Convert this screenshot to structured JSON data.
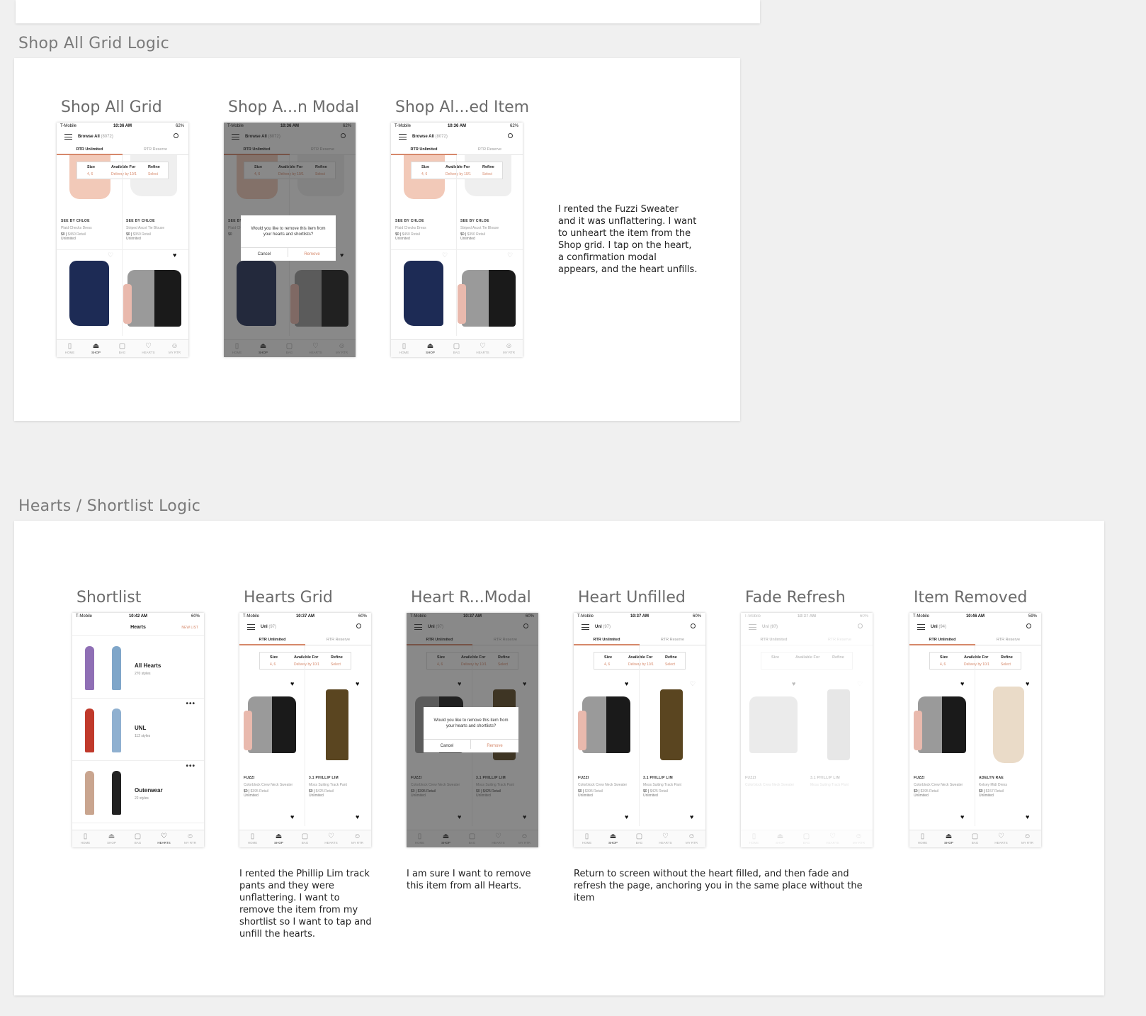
{
  "sections": {
    "shop": {
      "title": "Shop All Grid Logic"
    },
    "hearts": {
      "title": "Hearts / Shortlist Logic"
    }
  },
  "screens": {
    "shop_grid": "Shop All Grid",
    "shop_modal": "Shop A...n Modal",
    "shop_removed": "Shop Al...ed Item",
    "shortlist": "Shortlist",
    "hearts_grid": "Hearts Grid",
    "heart_modal": "Heart R...Modal",
    "heart_unfilled": "Heart Unfilled",
    "fade_refresh": "Fade Refresh",
    "item_removed": "Item Removed"
  },
  "notes": {
    "shop": "I rented the Fuzzi Sweater and it was unflattering. I want to unheart the item from the Shop grid. I tap on the heart, a confirmation modal appears, and the heart unfills.",
    "hearts_grid": "I rented the Phillip Lim track pants and they were unflattering. I want to remove the item from my shortlist so I want to tap and unfill the hearts.",
    "heart_modal": "I am sure I want to remove this item from all Hearts.",
    "refresh": "Return to screen without the heart filled, and then fade and refresh the page, anchoring you in the same place without the item"
  },
  "phone": {
    "carrier": "T-Mobile",
    "battery_62": "62%",
    "battery_60": "60%",
    "battery_59": "59%",
    "time_1036": "10:36 AM",
    "time_1037": "10:37 AM",
    "time_1042": "10:42 AM",
    "time_1046": "10:46 AM",
    "browse_title": "Browse All",
    "browse_count": "(8072)",
    "unl_title": "Unl",
    "unl_count_97": "(97)",
    "unl_count_94": "(94)",
    "tab_unlimited": "RTR Unlimited",
    "tab_reserve": "RTR Reserve",
    "filter_size": "Size",
    "filter_size_sub": "4, 6",
    "filter_available": "Available For",
    "filter_available_sub": "Delivery by 10/1",
    "filter_refine": "Refine",
    "filter_refine_sub": "Select",
    "modal_message": "Would you like to remove this item from your hearts and shortlists?",
    "modal_cancel": "Cancel",
    "modal_remove": "Remove",
    "tabbar": [
      "HOME",
      "SHOP",
      "BAG",
      "HEARTS",
      "MY RTR"
    ]
  },
  "products": {
    "chloe1": {
      "brand": "SEE BY CHLOE",
      "name": "Plaid Checks Dress",
      "price": "$0",
      "retail": "$450 Retail",
      "unl": "Unlimited"
    },
    "chloe2": {
      "brand": "SEE BY CHLOE",
      "name": "Striped Ascot Tie Blouse",
      "price": "$0",
      "retail": "$350 Retail",
      "unl": "Unlimited"
    },
    "fuzzi": {
      "brand": "FUZZI",
      "name": "Colorblock Crew Neck Sweater",
      "price": "$0",
      "retail": "$395 Retail",
      "unl": "Unlimited"
    },
    "lim": {
      "brand": "3.1 PHILLIP LIM",
      "name": "Moss Suiting Track Pant",
      "price": "$0",
      "retail": "$425 Retail",
      "unl": "Unlimited"
    },
    "adelyn": {
      "brand": "ADELYN RAE",
      "name": "Kelsey Midi Dress",
      "price": "$0",
      "retail": "$157 Retail",
      "unl": "Unlimited"
    }
  },
  "shortlist": {
    "title": "Hearts",
    "new_list": "NEW LIST",
    "lists": [
      {
        "name": "All Hearts",
        "count": "270 styles"
      },
      {
        "name": "UNL",
        "count": "112 styles"
      },
      {
        "name": "Outerwear",
        "count": "22 styles"
      }
    ],
    "more": "•••"
  },
  "icons": {
    "heart_filled": "heart-filled-icon",
    "heart_empty": "heart-outline-icon",
    "menu": "hamburger-menu-icon",
    "search": "search-icon"
  },
  "colors": {
    "accent": "#d6886a",
    "canvas": "#f0f0f0"
  }
}
